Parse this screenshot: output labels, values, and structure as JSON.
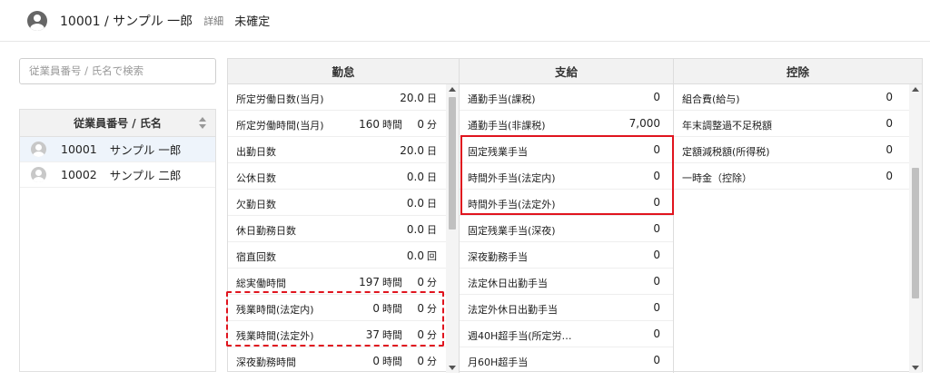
{
  "header": {
    "employee": "10001 / サンプル 一郎",
    "detail_link": "詳細",
    "status": "未確定"
  },
  "search": {
    "placeholder": "従業員番号 / 氏名で検索"
  },
  "employee_list": {
    "header": "従業員番号 / 氏名",
    "rows": [
      {
        "code": "10001",
        "name": "サンプル 一郎"
      },
      {
        "code": "10002",
        "name": "サンプル 二郎"
      }
    ]
  },
  "attendance": {
    "title": "勤怠",
    "rows": [
      {
        "label": "所定労働日数(当月)",
        "value": "20.0",
        "unit": "日"
      },
      {
        "label": "所定労働時間(当月)",
        "value": "160",
        "unit": "時間",
        "value2": "0",
        "unit2": "分"
      },
      {
        "label": "出勤日数",
        "value": "20.0",
        "unit": "日"
      },
      {
        "label": "公休日数",
        "value": "0.0",
        "unit": "日"
      },
      {
        "label": "欠勤日数",
        "value": "0.0",
        "unit": "日"
      },
      {
        "label": "休日勤務日数",
        "value": "0.0",
        "unit": "日"
      },
      {
        "label": "宿直回数",
        "value": "0.0",
        "unit": "回"
      },
      {
        "label": "総実働時間",
        "value": "197",
        "unit": "時間",
        "value2": "0",
        "unit2": "分"
      },
      {
        "label": "残業時間(法定内)",
        "value": "0",
        "unit": "時間",
        "value2": "0",
        "unit2": "分"
      },
      {
        "label": "残業時間(法定外)",
        "value": "37",
        "unit": "時間",
        "value2": "0",
        "unit2": "分"
      },
      {
        "label": "深夜勤務時間",
        "value": "0",
        "unit": "時間",
        "value2": "0",
        "unit2": "分"
      }
    ]
  },
  "payments": {
    "title": "支給",
    "rows": [
      {
        "label": "通勤手当(課税)",
        "value": "0"
      },
      {
        "label": "通勤手当(非課税)",
        "value": "7,000"
      },
      {
        "label": "固定残業手当",
        "value": "0"
      },
      {
        "label": "時間外手当(法定内)",
        "value": "0"
      },
      {
        "label": "時間外手当(法定外)",
        "value": "0"
      },
      {
        "label": "固定残業手当(深夜)",
        "value": "0"
      },
      {
        "label": "深夜勤務手当",
        "value": "0"
      },
      {
        "label": "法定休日出勤手当",
        "value": "0"
      },
      {
        "label": "法定外休日出勤手当",
        "value": "0"
      },
      {
        "label": "週40H超手当(所定労…",
        "value": "0"
      },
      {
        "label": "月60H超手当",
        "value": "0"
      }
    ]
  },
  "deductions": {
    "title": "控除",
    "rows": [
      {
        "label": "組合費(給与)",
        "value": "0"
      },
      {
        "label": "年末調整過不足税額",
        "value": "0"
      },
      {
        "label": "定額減税額(所得税)",
        "value": "0"
      },
      {
        "label": "一時金（控除）",
        "value": "0"
      }
    ]
  },
  "colors": {
    "highlight": "#e0141e",
    "selected_row": "#eef4fb"
  },
  "icons": [
    "user-avatar-icon",
    "sort-icon",
    "scroll-up-icon",
    "scroll-down-icon"
  ]
}
